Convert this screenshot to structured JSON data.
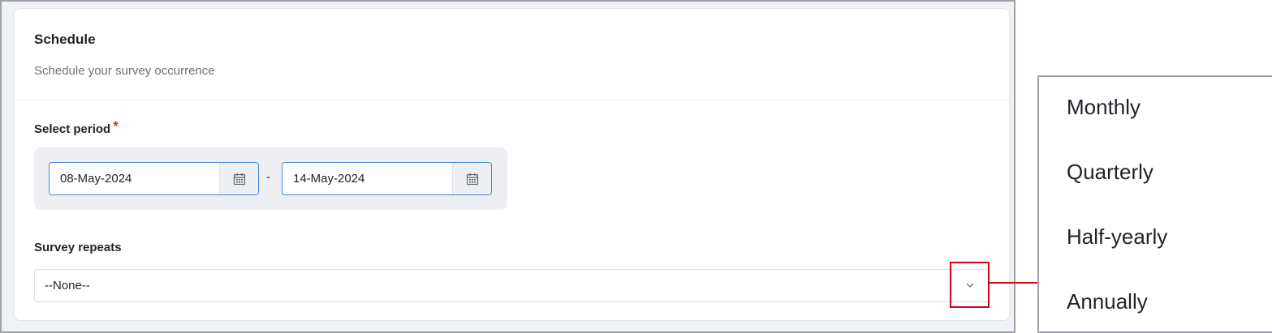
{
  "schedule": {
    "title": "Schedule",
    "subtitle": "Schedule your survey occurrence"
  },
  "period": {
    "label": "Select period",
    "required_mark": "*",
    "start_date": "08-May-2024",
    "separator": "-",
    "end_date": "14-May-2024"
  },
  "repeats": {
    "label": "Survey repeats",
    "selected": "--None--"
  },
  "dropdown_options": [
    "Monthly",
    "Quarterly",
    "Half-yearly",
    "Annually"
  ],
  "colors": {
    "accent_border": "#4a86d8",
    "required": "#e02f2f",
    "callout": "#d0021b"
  },
  "icons": {
    "calendar": "calendar-icon",
    "chevron": "chevron-down-icon"
  }
}
